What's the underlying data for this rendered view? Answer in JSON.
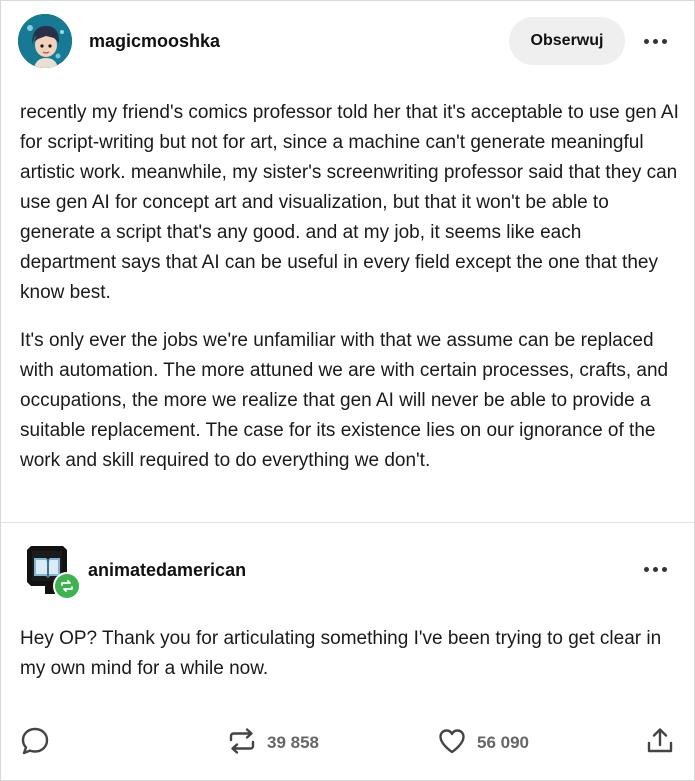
{
  "post": {
    "author": "magicmooshka",
    "follow_label": "Obserwuj",
    "paragraphs": [
      "recently my friend's comics professor told her that it's acceptable to use gen AI for script-writing but not for art, since a machine can't generate meaningful artistic work. meanwhile, my sister's screenwriting professor said that they can use gen AI for concept art and visualization, but that it won't be able to generate a script that's any good. and at my job, it seems like each department says that AI can be useful in every field except the one that they know best.",
      "It's only ever the jobs we're unfamiliar with that we assume can be replaced with automation. The more attuned we are with certain processes, crafts, and occupations, the more we realize that gen AI will never be able to provide a suitable replacement. The case for its existence lies on our ignorance of the work and skill required to do everything we don't."
    ]
  },
  "reblog": {
    "author": "animatedamerican",
    "text": "Hey OP? Thank you for articulating something I've been trying to get clear in my own mind for a while now."
  },
  "footer": {
    "reblog_count": "39 858",
    "like_count": "56 090"
  },
  "icons": {
    "more": "more-dots-icon",
    "reply": "speech-bubble-icon",
    "reblog": "reblog-arrows-icon",
    "like": "heart-icon",
    "share": "share-upload-icon",
    "reblog_badge": "reblog-badge-icon"
  },
  "colors": {
    "reblog_green": "#3fb34f",
    "follow_bg": "#efefef",
    "icon_gray": "#555555"
  }
}
